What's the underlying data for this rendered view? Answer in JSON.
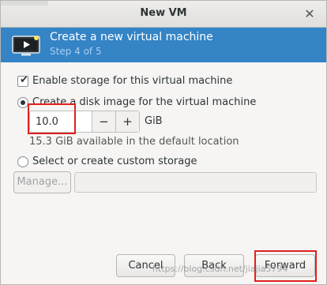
{
  "window": {
    "title": "New VM"
  },
  "banner": {
    "title": "Create a new virtual machine",
    "step": "Step 4 of 5"
  },
  "storage": {
    "enable_label": "Enable storage for this virtual machine",
    "enable_checked": true,
    "create_disk_label": "Create a disk image for the virtual machine",
    "create_disk_selected": true,
    "size_value": "10.0",
    "size_unit": "GiB",
    "minus_label": "−",
    "plus_label": "+",
    "available_text": "15.3 GiB available in the default location",
    "custom_label": "Select or create custom storage",
    "custom_selected": false,
    "manage_label": "Manage...",
    "custom_path": ""
  },
  "buttons": {
    "cancel": "Cancel",
    "back": "Back",
    "forward": "Forward"
  },
  "watermark": "https://blog.csdn.net/jiajia5794",
  "colors": {
    "banner": "#3484c6",
    "highlight": "#e02020"
  }
}
